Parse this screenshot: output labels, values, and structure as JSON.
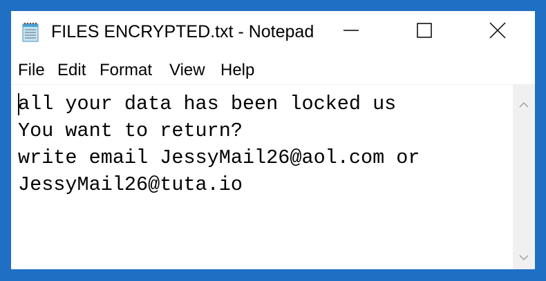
{
  "window": {
    "title": "FILES ENCRYPTED.txt - Notepad",
    "app_icon": "notepad-icon"
  },
  "title_controls": {
    "minimize_icon": "minimize-icon",
    "maximize_icon": "maximize-icon",
    "close_icon": "close-icon"
  },
  "menu": {
    "items": [
      {
        "label": "File"
      },
      {
        "label": "Edit"
      },
      {
        "label": "Format"
      },
      {
        "label": "View"
      },
      {
        "label": "Help"
      }
    ]
  },
  "editor": {
    "lines": [
      "all your data has been locked us",
      "You want to return?",
      "write email JessyMail26@aol.com or",
      "JessyMail26@tuta.io"
    ]
  },
  "scrollbar": {
    "up_icon": "scroll-up-arrow-icon",
    "down_icon": "scroll-down-arrow-icon"
  },
  "colors": {
    "frame": "#1f6fc5",
    "window_bg": "#ffffff",
    "scrollbar_bg": "#f0f0f0",
    "text": "#000000"
  }
}
